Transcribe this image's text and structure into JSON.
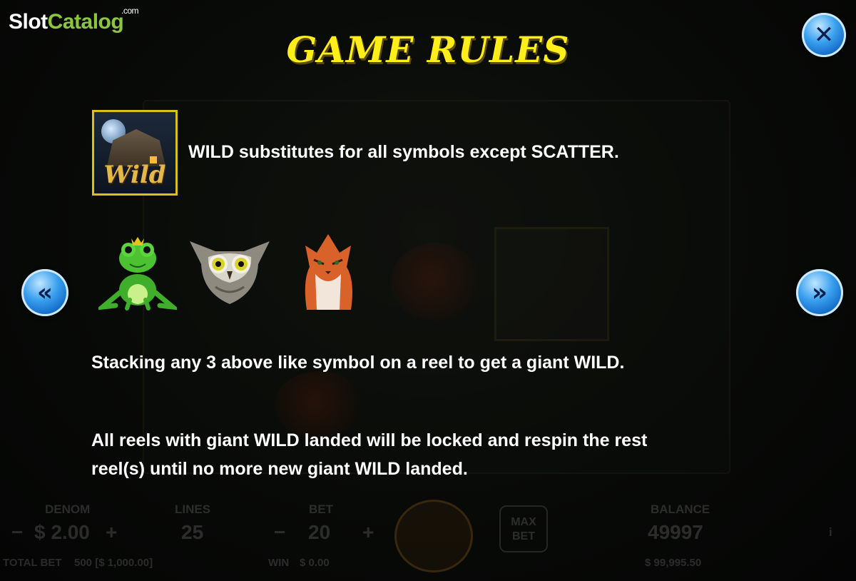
{
  "brand": {
    "slot": "Slot",
    "catalog": "Catalog",
    "com": ".com"
  },
  "title": "GAME RULES",
  "buttons": {
    "close": "✕",
    "prev": "«",
    "next": "»"
  },
  "wild_symbol": {
    "label": "Wild"
  },
  "rules": {
    "wild": "WILD substitutes for all symbols except SCATTER.",
    "stacking": "Stacking any 3 above like symbol on a reel to get a giant WILD.",
    "locked_line1": "All reels with giant WILD landed will be locked and respin the rest",
    "locked_line2": "reel(s) until no more new giant WILD landed."
  },
  "symbols": [
    "frog-icon",
    "owl-icon",
    "cat-icon"
  ],
  "bottom_bar": {
    "denom_label": "DENOM",
    "denom_value": "$ 2.00",
    "lines_label": "LINES",
    "lines_value": "25",
    "bet_label": "BET",
    "bet_value": "20",
    "maxbet_line1": "MAX",
    "maxbet_line2": "BET",
    "balance_label": "BALANCE",
    "balance_value": "49997",
    "total_bet_label": "TOTAL BET",
    "total_bet_value": "500 [$ 1,000.00]",
    "win_label": "WIN",
    "win_value": "$ 0.00",
    "balance_money": "$ 99,995.50",
    "info": "i",
    "minus": "−",
    "plus": "+"
  },
  "colors": {
    "title": "#ffee1a",
    "brand_green": "#8cc63f",
    "button_blue": "#2f8fe6",
    "wild_border": "#d8c21a"
  }
}
